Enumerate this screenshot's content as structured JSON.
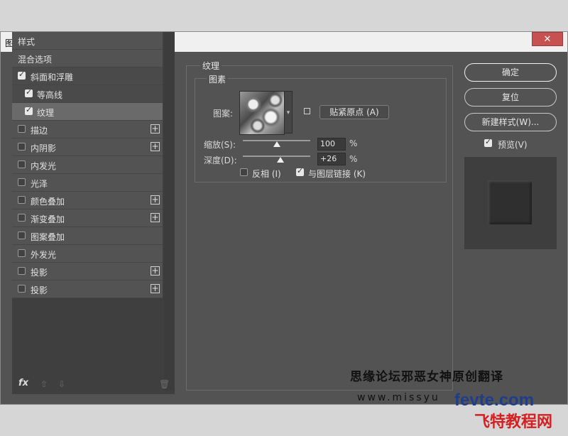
{
  "window": {
    "title": "图层样式",
    "close_glyph": "✕"
  },
  "left": {
    "items": [
      {
        "label": "样式",
        "type": "header"
      },
      {
        "label": "混合选项",
        "type": "header"
      },
      {
        "label": "斜面和浮雕",
        "checked": true
      },
      {
        "label": "等高线",
        "checked": true,
        "sub": true
      },
      {
        "label": "纹理",
        "checked": true,
        "sub": true,
        "selected": true
      },
      {
        "label": "描边",
        "checked": false,
        "plus": true
      },
      {
        "label": "内阴影",
        "checked": false,
        "plus": true
      },
      {
        "label": "内发光",
        "checked": false
      },
      {
        "label": "光泽",
        "checked": false
      },
      {
        "label": "颜色叠加",
        "checked": false,
        "plus": true
      },
      {
        "label": "渐变叠加",
        "checked": false,
        "plus": true
      },
      {
        "label": "图案叠加",
        "checked": false
      },
      {
        "label": "外发光",
        "checked": false
      },
      {
        "label": "投影",
        "checked": false,
        "plus": true
      },
      {
        "label": "投影",
        "checked": false,
        "plus": true
      }
    ],
    "bottom": {
      "fx": "fx",
      "up": "⇧",
      "down": "⇩",
      "trash": "🗑"
    }
  },
  "texture": {
    "group_title": "纹理",
    "subgroup_title": "图素",
    "pattern_label": "图案:",
    "snap_button": "贴紧原点 (A)",
    "scale_label": "缩放(S):",
    "scale_value": "100",
    "scale_percent": 0.5,
    "depth_label": "深度(D):",
    "depth_value": "+26",
    "depth_percent": 0.56,
    "unit": "%",
    "invert_label": "反相 (I)",
    "invert_checked": false,
    "link_label": "与图层链接 (K)",
    "link_checked": true
  },
  "right": {
    "ok": "确定",
    "reset": "复位",
    "new_style": "新建样式(W)...",
    "preview_label": "预览(V)",
    "preview_checked": true
  },
  "watermark": {
    "line1": "思缘论坛邪恶女神原创翻译",
    "line2": "www.missyu",
    "brand": "fevte.com",
    "brand_cn": "飞特教程网"
  }
}
